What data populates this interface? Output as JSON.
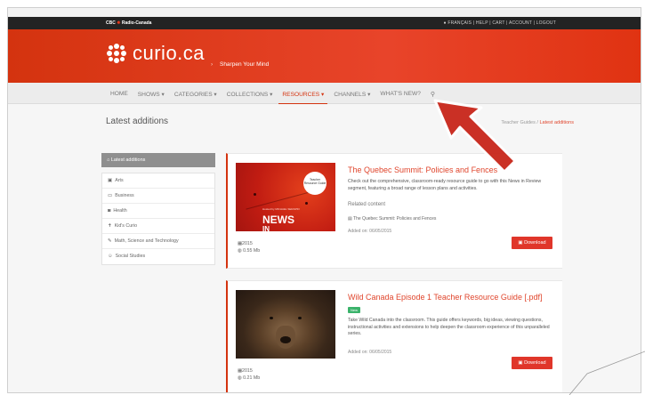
{
  "topbar": {
    "brand": "CBC",
    "brand2": "Radio-Canada",
    "links": "FRANÇAIS | HELP | CART | ACCOUNT | LOGOUT"
  },
  "header": {
    "logo_text": "curio.ca",
    "tagline": "Sharpen Your Mind"
  },
  "nav": {
    "items": [
      {
        "label": "HOME"
      },
      {
        "label": "SHOWS ▾"
      },
      {
        "label": "CATEGORIES ▾"
      },
      {
        "label": "COLLECTIONS ▾"
      },
      {
        "label": "RESOURCES ▾"
      },
      {
        "label": "CHANNELS ▾"
      },
      {
        "label": "WHAT'S NEW?"
      }
    ],
    "active_index": 4
  },
  "page": {
    "title": "Latest additions",
    "breadcrumb_parent": "Teacher Guides",
    "breadcrumb_current": "Latest additions"
  },
  "sidebar": {
    "header": "Latest additions",
    "items": [
      {
        "label": "Arts",
        "icon": "image-icon"
      },
      {
        "label": "Business",
        "icon": "briefcase-icon"
      },
      {
        "label": "Health",
        "icon": "camera-icon"
      },
      {
        "label": "Kid's Curio",
        "icon": "person-icon"
      },
      {
        "label": "Math, Science and Technology",
        "icon": "pencil-icon"
      },
      {
        "label": "Social Studies",
        "icon": "group-icon"
      }
    ]
  },
  "cards": [
    {
      "title": "The Quebec Summit: Policies and Fences",
      "description": "Check out the comprehensive, classroom-ready resource guide to go with this News in Review segment, featuring a broad range of lesson plans and activities.",
      "related_heading": "Related content",
      "related_link": "The Quebec Summit: Policies and Fences",
      "added": "Added on: 06/05/2015",
      "year": "2015",
      "size": "0.55 Mb",
      "download": "Download",
      "thumb_badge": "Teacher Resource Guide",
      "thumb_big": "NEWS",
      "thumb_big2": "IN",
      "thumb_tiny": "Hosted by MICHAEL SERAPIO"
    },
    {
      "title": "Wild Canada Episode 1 Teacher Resource Guide [.pdf]",
      "badge": "New",
      "description": "Take Wild Canada into the classroom. This guide offers keywords, big ideas, viewing questions, instructional activities and extensions to help deepen the classroom experience of this unparalleled series.",
      "added": "Added on: 06/05/2015",
      "year": "2015",
      "size": "0.21 Mb",
      "download": "Download"
    }
  ],
  "colors": {
    "brand_red": "#d4330f",
    "accent_link": "#e0462d",
    "new_badge": "#3bb36b"
  }
}
